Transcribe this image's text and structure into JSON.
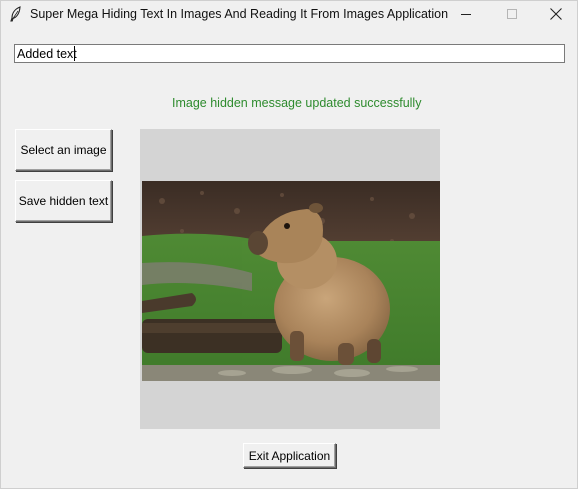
{
  "window": {
    "title": "Super Mega Hiding Text In Images And Reading It From Images Application",
    "icon": "feather-icon",
    "controls": [
      "minimize-icon",
      "maximize-icon",
      "close-icon"
    ]
  },
  "text_entry": {
    "value": "Added text"
  },
  "status": {
    "message": "Image hidden message updated successfully",
    "color": "#2e8b2e"
  },
  "buttons": {
    "select_image": "Select an image",
    "save_hidden_text": "Save hidden text",
    "exit": "Exit Application"
  },
  "image": {
    "subject": "capybara sitting on grass beside a log",
    "frame_color": "#d4d4d4"
  }
}
